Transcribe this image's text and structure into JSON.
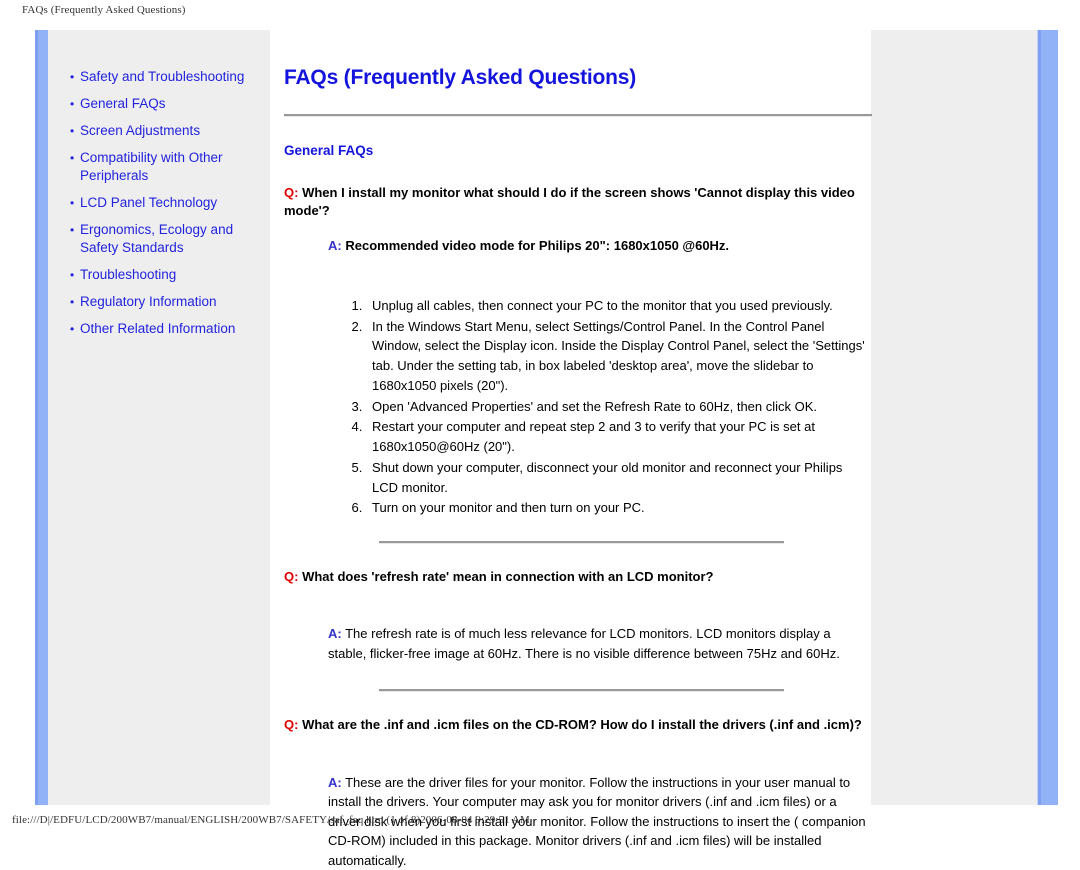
{
  "print": {
    "header": "FAQs (Frequently Asked Questions)",
    "footer": "file:///D|/EDFU/LCD/200WB7/manual/ENGLISH/200WB7/SAFETY/saf_faq.htm (1 of 8)2006-08-04 9:29:51 AM"
  },
  "colors": {
    "link_blue": "#2222dd",
    "title_blue": "#1414dd",
    "q_red": "#e00000",
    "a_blue": "#3333cc",
    "panel_grey": "#eeeeee",
    "accent_blue": "#92b2f8",
    "rule_grey": "#999999"
  },
  "sidebar": {
    "bullet": "•",
    "items": [
      {
        "label": "Safety and Troubleshooting"
      },
      {
        "label": "General FAQs"
      },
      {
        "label": "Screen Adjustments"
      },
      {
        "label": "Compatibility with Other Peripherals"
      },
      {
        "label": "LCD Panel Technology"
      },
      {
        "label": "Ergonomics, Ecology and Safety Standards"
      },
      {
        "label": "Troubleshooting"
      },
      {
        "label": "Regulatory Information"
      },
      {
        "label": "Other Related Information"
      }
    ]
  },
  "main": {
    "title": "FAQs (Frequently Asked Questions)",
    "section_heading": "General FAQs",
    "q_label": "Q:",
    "a_label": "A:",
    "qa": [
      {
        "question": "When I install my monitor what should I do if the screen shows 'Cannot display this video mode'?",
        "answer": "Recommended video mode for Philips 20\": 1680x1050 @60Hz.",
        "steps": [
          "Unplug all cables, then connect your PC to the monitor that you used previously.",
          "In the Windows Start Menu, select Settings/Control Panel. In the Control Panel Window, select the Display icon. Inside the Display Control Panel, select the 'Settings' tab. Under the setting tab, in box labeled 'desktop area', move the slidebar to 1680x1050 pixels (20\").",
          "Open 'Advanced Properties' and set the Refresh Rate to 60Hz, then click OK.",
          "Restart your computer and repeat step 2 and 3 to verify that your PC is set at 1680x1050@60Hz (20\").",
          "Shut down your computer, disconnect your old monitor and reconnect your Philips LCD monitor.",
          "Turn on your monitor and then turn on your PC."
        ]
      },
      {
        "question": "What does 'refresh rate' mean in connection with an LCD monitor?",
        "answer": "The refresh rate is of much less relevance for LCD monitors. LCD monitors display a stable, flicker-free image at 60Hz. There is no visible difference between 75Hz and 60Hz."
      },
      {
        "question": "What are the .inf and .icm files on the CD-ROM? How do I install the drivers (.inf and .icm)?",
        "answer": "These are the driver files for your monitor. Follow the instructions in your user manual to install the drivers. Your computer may ask you for monitor drivers (.inf and .icm files) or a driver disk when you first install your monitor. Follow the instructions to insert the ( companion CD-ROM) included in this package. Monitor drivers (.inf and .icm files) will be installed automatically."
      }
    ]
  }
}
